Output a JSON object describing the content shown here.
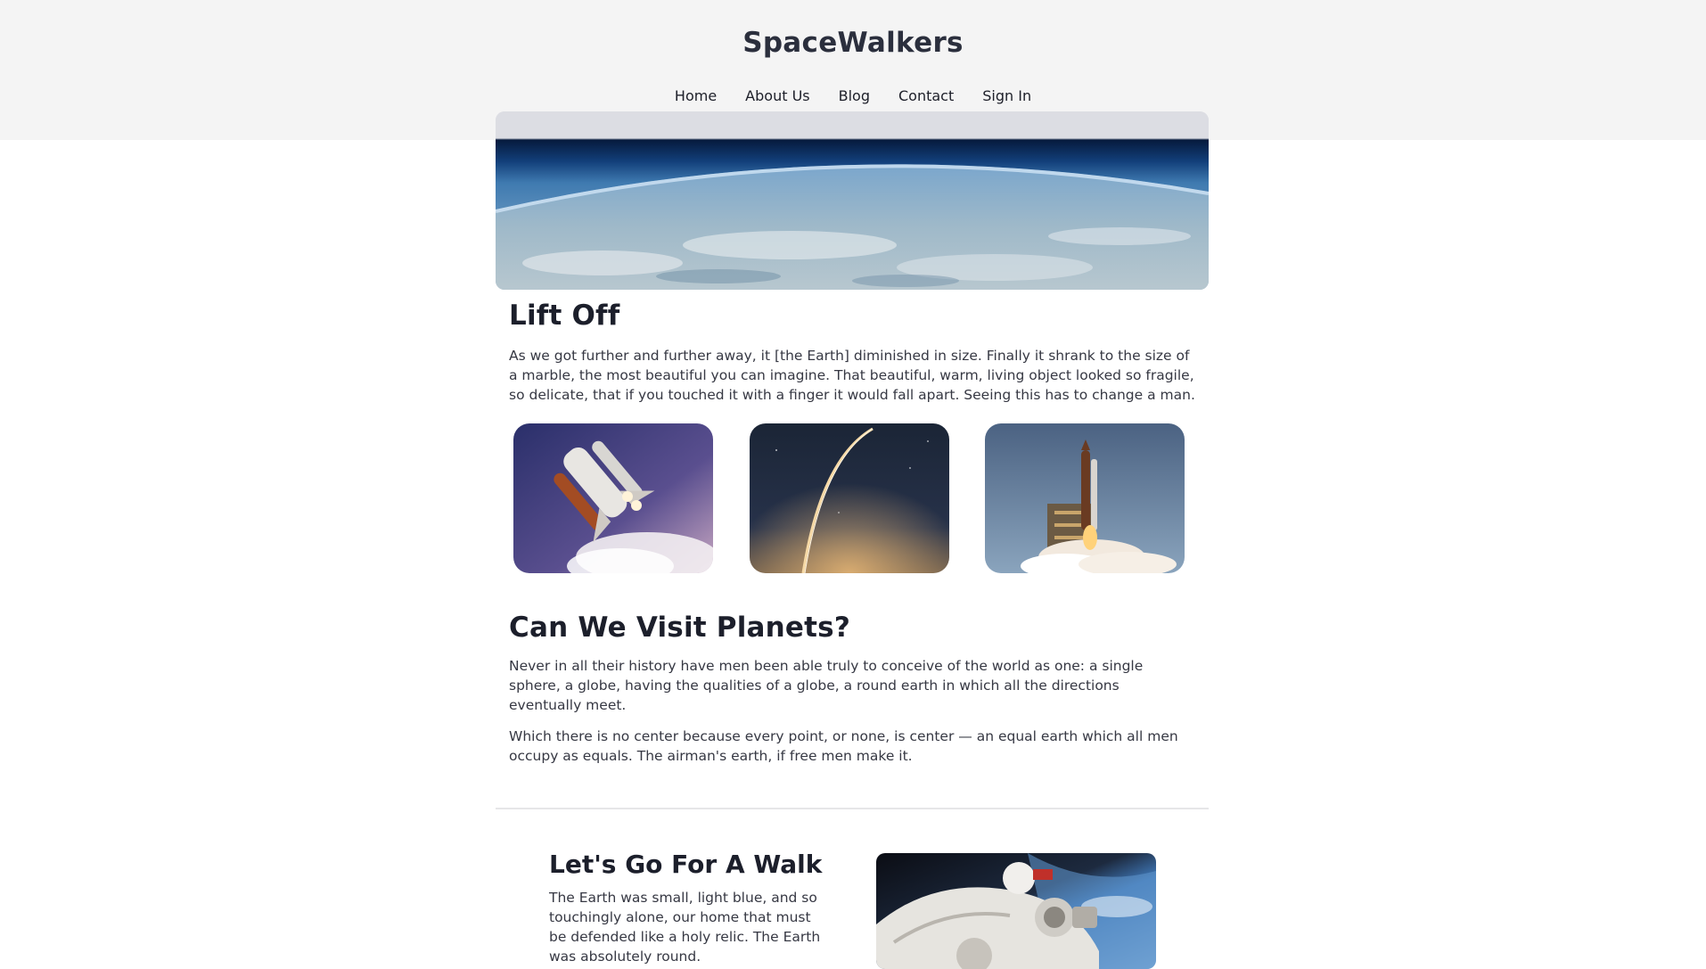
{
  "site": {
    "title": "SpaceWalkers"
  },
  "nav": {
    "items": [
      "Home",
      "About Us",
      "Blog",
      "Contact",
      "Sign In"
    ]
  },
  "lift_off": {
    "heading": "Lift Off",
    "paragraph": "As we got further and further away, it [the Earth] diminished in size. Finally it shrank to the size of a marble, the most beautiful you can imagine. That beautiful, warm, living object looked so fragile, so delicate, that if you touched it with a finger it would fall apart. Seeing this has to change a man."
  },
  "planets": {
    "heading": "Can We Visit Planets?",
    "paragraphs": [
      "Never in all their history have men been able truly to conceive of the world as one: a single sphere, a globe, having the qualities of a globe, a round earth in which all the directions eventually meet.",
      "Which there is no center because every point, or none, is center — an equal earth which all men occupy as equals. The airman's earth, if free men make it."
    ]
  },
  "walk": {
    "heading": "Let's Go For A Walk",
    "paragraph": "The Earth was small, light blue, and so touchingly alone, our home that must be defended like a holy relic. The Earth was absolutely round."
  },
  "images": {
    "hero": "earth-horizon-image",
    "thumbs": [
      "space-shuttle-launch-image",
      "rocket-trail-image",
      "launch-pad-image"
    ],
    "walk": "astronaut-image"
  },
  "colors": {
    "header_bg": "#f4f4f4",
    "heading": "#1c1f2b",
    "body_text": "#363843"
  }
}
